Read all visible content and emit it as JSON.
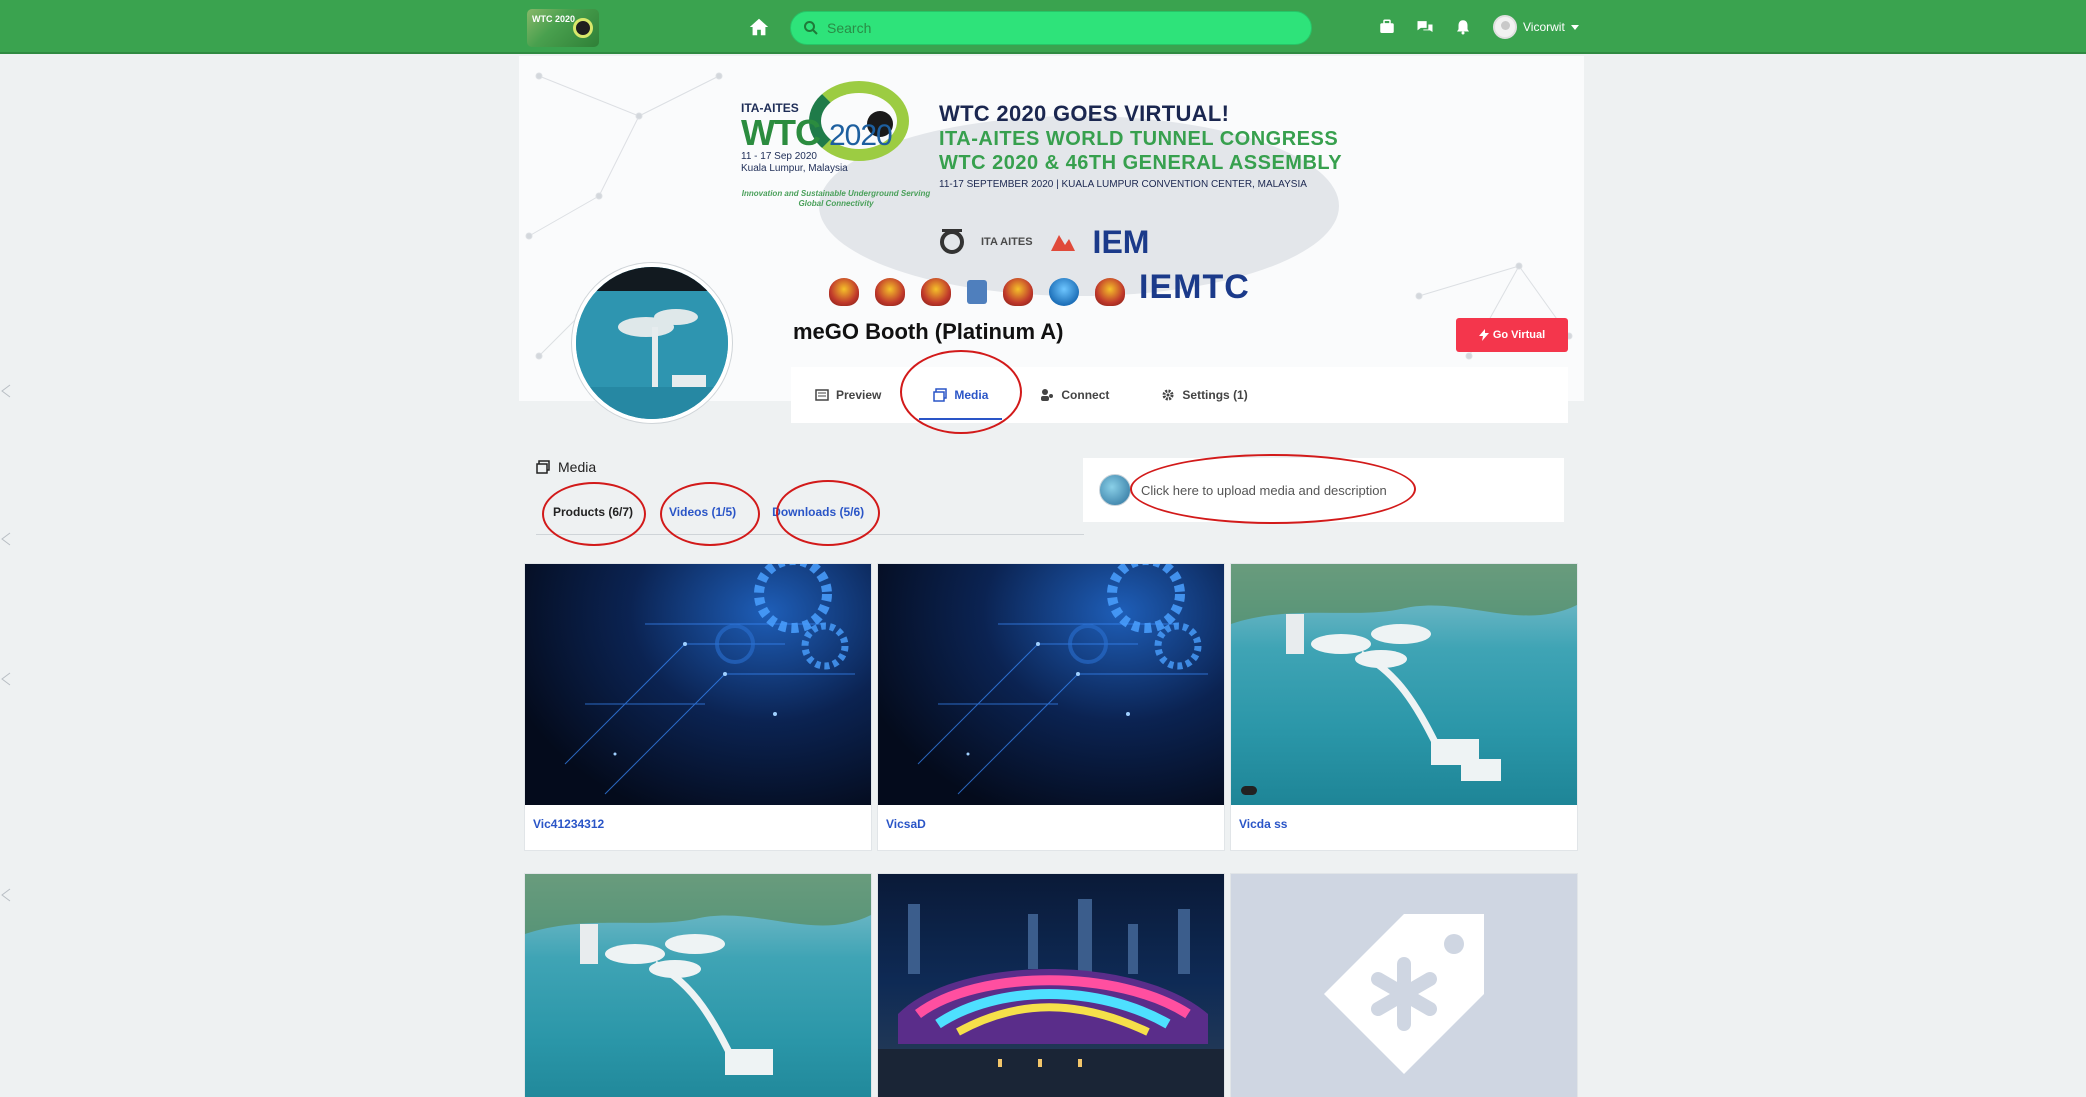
{
  "navbar": {
    "logo_text": "WTC 2020",
    "search_placeholder": "Search",
    "user_name": "Vicorwit"
  },
  "banner": {
    "logo_org": "ITA-AITES",
    "logo_wtc": "WTC",
    "logo_year": "2020",
    "logo_dates": "11 - 17 Sep 2020",
    "logo_location": "Kuala Lumpur, Malaysia",
    "logo_tagline": "Innovation and Sustainable Underground Serving Global Connectivity",
    "headline_1": "WTC 2020 GOES VIRTUAL!",
    "headline_2": "ITA-AITES WORLD TUNNEL CONGRESS",
    "headline_3": "WTC 2020 & 46TH GENERAL ASSEMBLY",
    "headline_4": "11-17 SEPTEMBER 2020 | KUALA LUMPUR CONVENTION CENTER, MALAYSIA",
    "sponsor_1": "ITA AITES",
    "sponsor_2": "IEM",
    "sponsor_3": "IEMTC"
  },
  "profile": {
    "booth_name": "meGO Booth (Platinum A)",
    "go_virtual_label": "Go Virtual"
  },
  "tabs": [
    {
      "label": "Preview",
      "icon": "newspaper-icon"
    },
    {
      "label": "Media",
      "icon": "images-icon"
    },
    {
      "label": "Connect",
      "icon": "users-icon"
    },
    {
      "label": "Settings (1)",
      "icon": "gear-icon"
    }
  ],
  "media": {
    "section_title": "Media",
    "tabs": [
      "Products (6/7)",
      "Videos (1/5)",
      "Downloads (5/6)"
    ],
    "upload_prompt": "Click here to upload media and description"
  },
  "cards": [
    {
      "title": "Vic41234312",
      "image": "tech-gears"
    },
    {
      "title": "VicsaD",
      "image": "tech-gears"
    },
    {
      "title": "Vicda ss",
      "image": "island-resort"
    },
    {
      "title": "",
      "image": "island-resort"
    },
    {
      "title": "",
      "image": "night-stadium"
    },
    {
      "title": "",
      "image": "placeholder-tag"
    }
  ],
  "colors": {
    "navbar": "#3aa34f",
    "search": "#2ee37a",
    "accent": "#2a55c7",
    "go_virtual": "#f4364c",
    "annotation": "#d21a1a"
  }
}
